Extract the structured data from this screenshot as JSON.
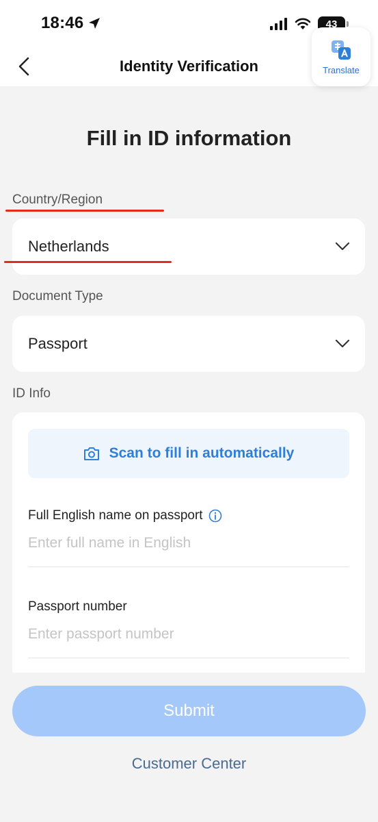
{
  "status_bar": {
    "time": "18:46",
    "battery": "43"
  },
  "header": {
    "title": "Identity Verification",
    "back_icon": "chevron-left-icon"
  },
  "translate": {
    "label": "Translate",
    "icon": "translate-icon"
  },
  "page_heading": "Fill in ID information",
  "country": {
    "label": "Country/Region",
    "value": "Netherlands"
  },
  "document_type": {
    "label": "Document Type",
    "value": "Passport"
  },
  "id_info": {
    "label": "ID Info",
    "scan_label": "Scan to fill in automatically",
    "full_name_label": "Full English name on passport",
    "full_name_placeholder": "Enter full name in English",
    "full_name_value": "",
    "passport_label": "Passport number",
    "passport_placeholder": "Enter passport number",
    "passport_value": ""
  },
  "submit_label": "Submit",
  "customer_center_label": "Customer Center",
  "colors": {
    "accent": "#2f7ed8",
    "submit_disabled": "#a4c8f9",
    "annotation_red": "#e02b1d",
    "background": "#f3f3f3"
  }
}
